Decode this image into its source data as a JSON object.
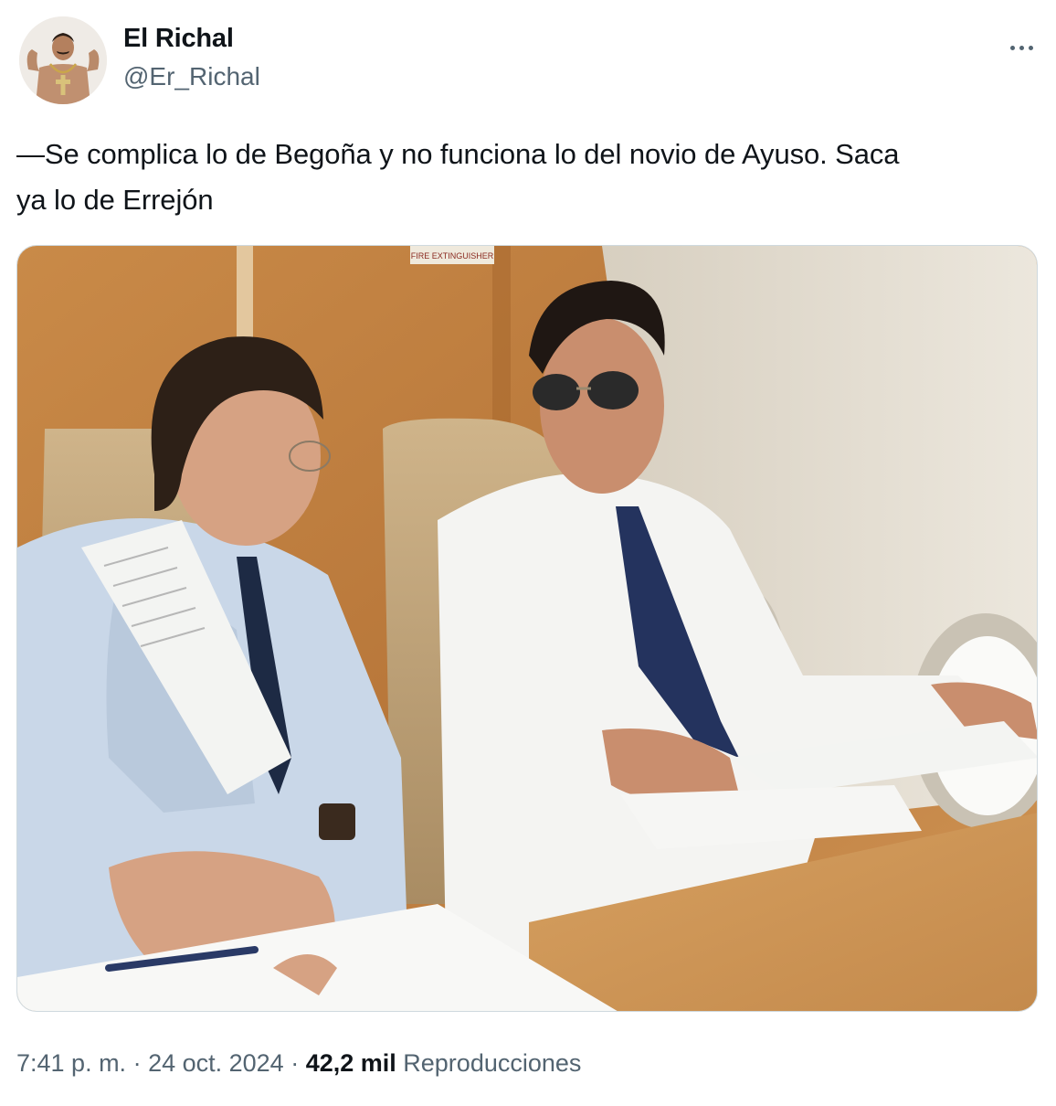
{
  "author": {
    "display_name": "El Richal",
    "handle": "@Er_Richal",
    "avatar_icon": "profile-photo"
  },
  "more_icon": "ellipsis-icon",
  "tweet": {
    "text_line1": "—Se complica lo de Begoña y no funciona lo del novio de Ayuso. Saca",
    "text_line2": "ya lo de Errejón"
  },
  "photo": {
    "sign_text": "FIRE EXTINGUISHER"
  },
  "meta": {
    "time": "7:41 p. m.",
    "sep1": " · ",
    "date": "24 oct. 2024",
    "sep2": " · ",
    "views_count": "42,2 mil",
    "views_label": "Reproducciones"
  },
  "colors": {
    "text_primary": "#0f1419",
    "text_secondary": "#536471",
    "border": "#cfd9de"
  }
}
